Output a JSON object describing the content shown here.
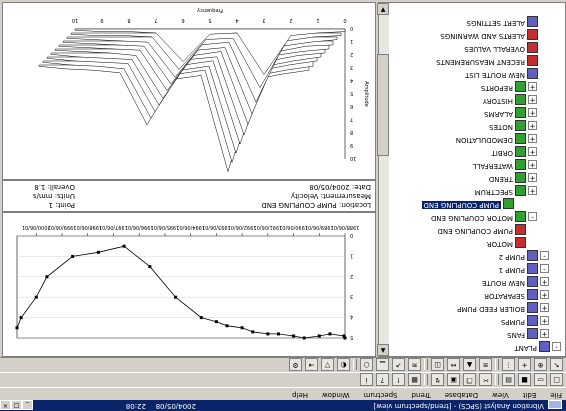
{
  "window": {
    "title": "Vibration Analyst (SPCS) - [trend/spectrum view]",
    "date": "2004/05/08",
    "time": "22:08"
  },
  "menu": [
    "File",
    "Edit",
    "View",
    "Database",
    "Trend",
    "Spectrum",
    "Window",
    "Help"
  ],
  "toolbar_row1_icons": [
    "new-icon",
    "open-icon",
    "save-icon",
    "print-icon",
    "cut-icon",
    "copy-icon",
    "paste-icon",
    "route-icon",
    "chart-icon",
    "warning-icon",
    "help-icon",
    "info-icon"
  ],
  "toolbar_row2_icons": [
    "select-icon",
    "zoom-icon",
    "cursor-icon",
    "harmonic-icon",
    "sideband-icon",
    "peak-icon",
    "measure-icon",
    "overlay-icon",
    "waterfall-icon",
    "trend-icon",
    "spectrum-icon",
    "orbit-icon",
    "color-icon",
    "filter-icon",
    "export-icon",
    "settings-icon"
  ],
  "tree": {
    "items": [
      {
        "label": "PLANT",
        "indent": 0,
        "expander": "-",
        "icon_color": "#6060c0"
      },
      {
        "label": "FANS",
        "indent": 1,
        "expander": "+",
        "icon_color": "#6060c0"
      },
      {
        "label": "PUMPS",
        "indent": 1,
        "expander": "+",
        "icon_color": "#6060c0"
      },
      {
        "label": "BOILER FEED PUMP",
        "indent": 1,
        "expander": "+",
        "icon_color": "#6060c0"
      },
      {
        "label": "SEPARATOR",
        "indent": 1,
        "expander": "+",
        "icon_color": "#6060c0"
      },
      {
        "label": "NEW ROUTE",
        "indent": 1,
        "expander": "+",
        "icon_color": "#6060c0"
      },
      {
        "label": "PUMP 1",
        "indent": 1,
        "expander": "-",
        "icon_color": "#6060c0"
      },
      {
        "label": "PUMP 2",
        "indent": 1,
        "expander": "-",
        "icon_color": "#6060c0"
      },
      {
        "label": "MOTOR",
        "indent": 2,
        "expander": "",
        "icon_color": "#c03030"
      },
      {
        "label": "PUMP COUPLING END",
        "indent": 2,
        "expander": "",
        "icon_color": "#c03030"
      },
      {
        "label": "MOTOR COUPLING END",
        "indent": 2,
        "expander": "-",
        "icon_color": "#30a030"
      },
      {
        "label": "PUMP COUPLING END",
        "indent": 3,
        "expander": "",
        "icon_color": "#30a030",
        "selected": true
      },
      {
        "label": "SPECTRUM",
        "indent": 2,
        "expander": "+",
        "icon_color": "#30a030"
      },
      {
        "label": "TREND",
        "indent": 2,
        "expander": "+",
        "icon_color": "#30a030"
      },
      {
        "label": "WATERFALL",
        "indent": 2,
        "expander": "+",
        "icon_color": "#30a030"
      },
      {
        "label": "ORBIT",
        "indent": 2,
        "expander": "+",
        "icon_color": "#30a030"
      },
      {
        "label": "DEMODULATION",
        "indent": 2,
        "expander": "+",
        "icon_color": "#30a030"
      },
      {
        "label": "NOTES",
        "indent": 2,
        "expander": "+",
        "icon_color": "#30a030"
      },
      {
        "label": "ALARMS",
        "indent": 2,
        "expander": "+",
        "icon_color": "#30a030"
      },
      {
        "label": "HISTORY",
        "indent": 2,
        "expander": "+",
        "icon_color": "#30a030"
      },
      {
        "label": "REPORTS",
        "indent": 2,
        "expander": "+",
        "icon_color": "#30a030"
      },
      {
        "label": "NEW ROUTE LIST",
        "indent": 1,
        "expander": "",
        "icon_color": "#6060c0"
      },
      {
        "label": "RECENT MEASUREMENTS",
        "indent": 1,
        "expander": "",
        "icon_color": "#c03030"
      },
      {
        "label": "OVERALL VALUES",
        "indent": 1,
        "expander": "",
        "icon_color": "#c03030"
      },
      {
        "label": "ALERTS AND WARNINGS",
        "indent": 1,
        "expander": "",
        "icon_color": "#c03030"
      },
      {
        "label": "ALERT SETTINGS",
        "indent": 1,
        "expander": "",
        "icon_color": "#6060c0"
      }
    ]
  },
  "info": {
    "line1_left": "Location: PUMP COUPLING END",
    "line1_right": "Point: 1",
    "line2_left": "Measurement: Velocity",
    "line2_right": "Units: mm/s",
    "line3_left": "Date: 2004/05/08",
    "line3_right": "Overall: 1.8"
  },
  "chart_data": [
    {
      "type": "line",
      "title": "",
      "xlabel": "",
      "ylabel": "",
      "x": [
        "1988-06-01",
        "1988-06-15",
        "1989-01-01",
        "1989-06-01",
        "1990-01-01",
        "1990-06-01",
        "1991-01-01",
        "1991-06-01",
        "1992-01-01",
        "1992-06-01",
        "1993-01-01",
        "1993-06-01",
        "1994-01-01",
        "1995-01-01",
        "1996-01-01",
        "1997-01-01",
        "1998-01-01",
        "1999-01-01",
        "2000-01-01",
        "2000-06-01",
        "2001-01-01",
        "2001-03-01"
      ],
      "series": [
        {
          "values": [
            5.0,
            4.9,
            4.8,
            4.9,
            5.0,
            4.9,
            4.8,
            4.8,
            4.7,
            4.5,
            4.4,
            4.2,
            4.0,
            3.0,
            1.5,
            0.5,
            0.8,
            1.0,
            2.0,
            3.0,
            4.0,
            4.5
          ]
        }
      ],
      "ylim": [
        0,
        5
      ],
      "x_ticks": [
        "1988/06/01",
        "1989/06/01",
        "1990/06/01",
        "1991/06/01",
        "1992/06/01",
        "1993/06/01",
        "1994/06/01",
        "1995/06/01",
        "1996/06/01",
        "1997/06/01",
        "1998/06/01",
        "1999/06/01",
        "2000/06/01",
        "2001/06/01"
      ]
    },
    {
      "type": "area",
      "title": "",
      "xlabel": "Frequency",
      "ylabel": "Amplitude",
      "xlim": [
        0,
        10
      ],
      "zlim": [
        0,
        10
      ],
      "x_ticks": [
        "0",
        "1",
        "2",
        "3",
        "4",
        "5",
        "6",
        "7",
        "8",
        "9",
        "10"
      ],
      "y_ticks": [
        "0",
        "1",
        "2",
        "3",
        "4",
        "5",
        "6",
        "7",
        "8",
        "9",
        "10"
      ],
      "series": [
        {
          "values": [
            0.2,
            0.3,
            0.5,
            3.5,
            0.3,
            0.4,
            2.5,
            0.3,
            0.2,
            0.2,
            0.1
          ]
        },
        {
          "values": [
            0.2,
            0.3,
            0.6,
            4.2,
            0.4,
            0.5,
            2.8,
            0.3,
            0.2,
            0.2,
            0.1
          ]
        },
        {
          "values": [
            0.2,
            0.4,
            0.7,
            5.0,
            0.4,
            0.6,
            3.1,
            0.4,
            0.3,
            0.2,
            0.1
          ]
        },
        {
          "values": [
            0.3,
            0.4,
            0.8,
            5.6,
            0.5,
            0.7,
            3.3,
            0.4,
            0.3,
            0.2,
            0.1
          ]
        },
        {
          "values": [
            0.3,
            0.5,
            0.8,
            6.1,
            0.5,
            0.8,
            3.5,
            0.4,
            0.3,
            0.2,
            0.1
          ]
        },
        {
          "values": [
            0.3,
            0.5,
            0.9,
            6.6,
            0.6,
            0.8,
            3.8,
            0.5,
            0.3,
            0.2,
            0.1
          ]
        },
        {
          "values": [
            0.3,
            0.6,
            1.0,
            7.0,
            0.6,
            0.9,
            4.0,
            0.5,
            0.4,
            0.3,
            0.1
          ]
        },
        {
          "values": [
            0.3,
            0.6,
            1.0,
            7.4,
            0.7,
            1.0,
            4.2,
            0.5,
            0.4,
            0.3,
            0.1
          ]
        },
        {
          "values": [
            0.4,
            0.7,
            1.1,
            7.8,
            0.7,
            1.0,
            4.4,
            0.6,
            0.4,
            0.3,
            0.1
          ]
        },
        {
          "values": [
            0.4,
            0.7,
            1.1,
            8.2,
            0.8,
            1.1,
            4.6,
            0.6,
            0.4,
            0.3,
            0.1
          ]
        }
      ]
    }
  ],
  "colors": {
    "title_bar": "#0a246a",
    "trend_line": "#000000",
    "face": "#d4d0c8"
  }
}
